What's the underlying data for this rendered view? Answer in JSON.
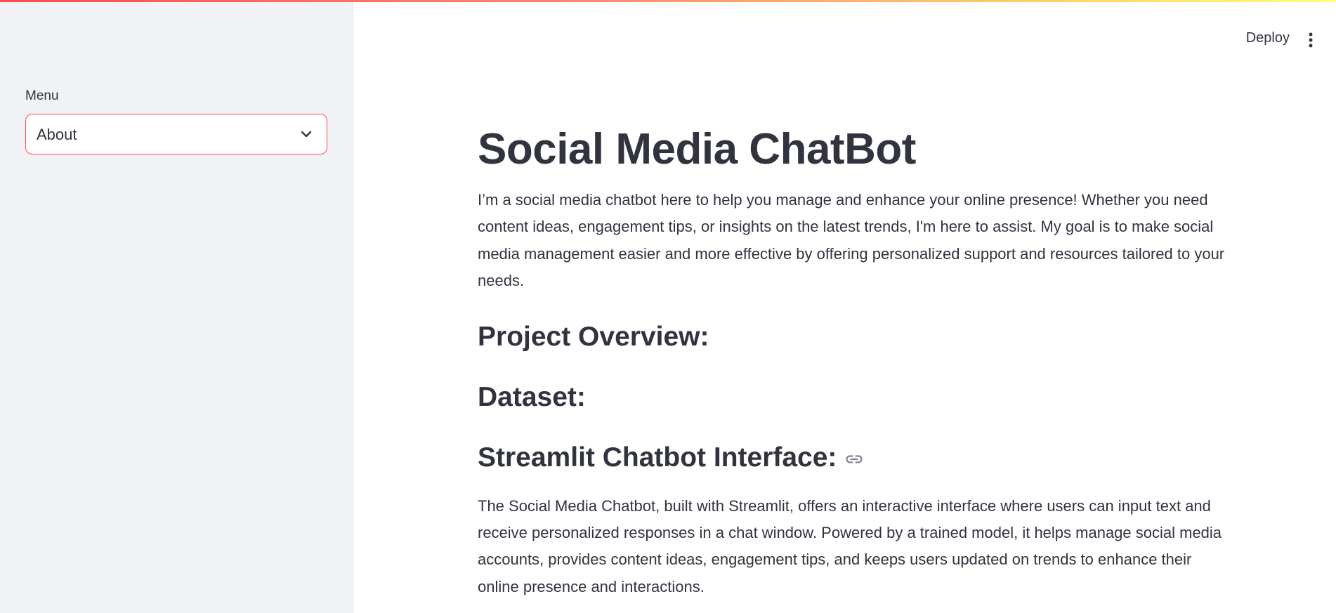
{
  "header": {
    "deploy_label": "Deploy",
    "menu_icon": "kebab-vertical-icon"
  },
  "sidebar": {
    "menu_label": "Menu",
    "select_value": "About",
    "select_icon": "chevron-down-icon",
    "accent_color": "#ff4b4b"
  },
  "main": {
    "title": "Social Media ChatBot",
    "intro": "I’m a social media chatbot here to help you manage and enhance your online presence! Whether you need content ideas, engagement tips, or insights on the latest trends, I'm here to assist. My goal is to make social media management easier and more effective by offering personalized support and resources tailored to your needs.",
    "section_overview": "Project Overview:",
    "section_dataset": "Dataset:",
    "section_interface": "Streamlit Chatbot Interface:",
    "interface_link_icon": "link-icon",
    "interface_text": "The Social Media Chatbot, built with Streamlit, offers an interactive interface where users can input text and receive personalized responses in a chat window. Powered by a trained model, it helps manage social media accounts, provides content ideas, engagement tips, and keeps users updated on trends to enhance their online presence and interactions."
  }
}
